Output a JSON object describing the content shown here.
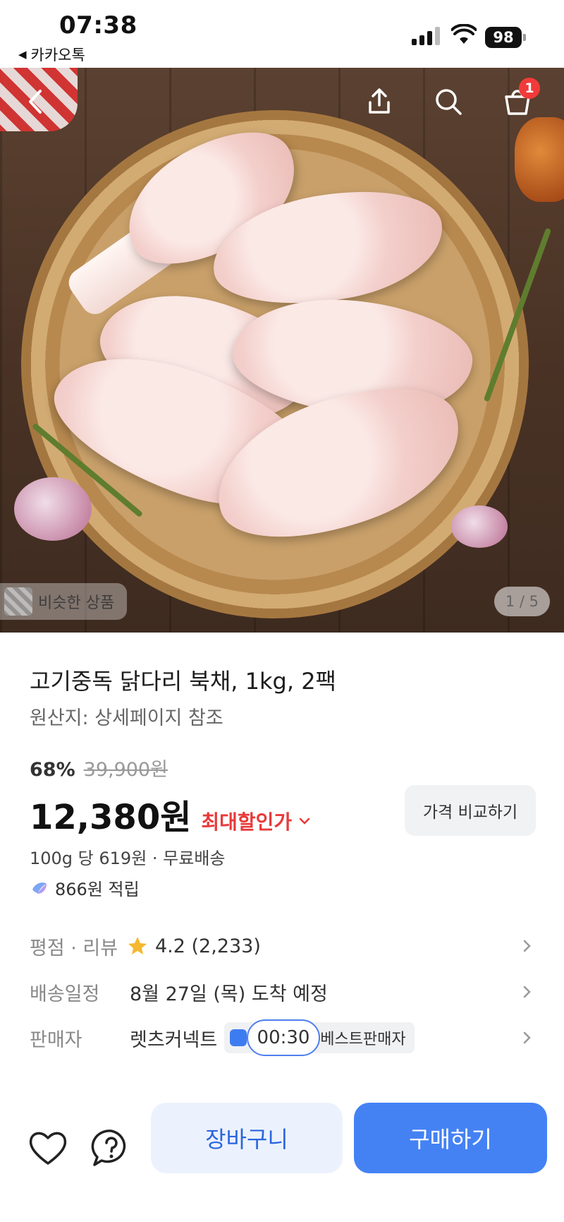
{
  "status_bar": {
    "time": "07:38",
    "back_app": "카카오톡",
    "battery": "98"
  },
  "hero": {
    "back_icon": "chevron-left-icon",
    "share_icon": "share-icon",
    "search_icon": "search-icon",
    "cart_icon": "cart-icon",
    "cart_badge": "1",
    "similar_label": "비슷한 상품",
    "pager": "1 / 5"
  },
  "product": {
    "title": "고기중독 닭다리 북채, 1kg, 2팩",
    "origin": "원산지: 상세페이지 참조",
    "discount": "68%",
    "original_price": "39,900원",
    "price": "12,380원",
    "max_discount_label": "최대할인가",
    "compare_label": "가격 비교하기",
    "unit_line": "100g 당 619원 · 무료배송",
    "points": "866원 적립"
  },
  "details": {
    "rating_label": "평점 · 리뷰",
    "rating_value": "4.2 (2,233)",
    "delivery_label": "배송일정",
    "delivery_value": "8월 27일 (목) 도착 예정",
    "seller_label": "판매자",
    "seller_name": "렛츠커넥트",
    "seller_badge": "베스트판매자",
    "timer": "00:30"
  },
  "actions": {
    "cart_label": "장바구니",
    "buy_label": "구매하기"
  },
  "colors": {
    "accent": "#4482f4",
    "discount_red": "#e83a3a",
    "badge_red": "#f23a3a"
  }
}
